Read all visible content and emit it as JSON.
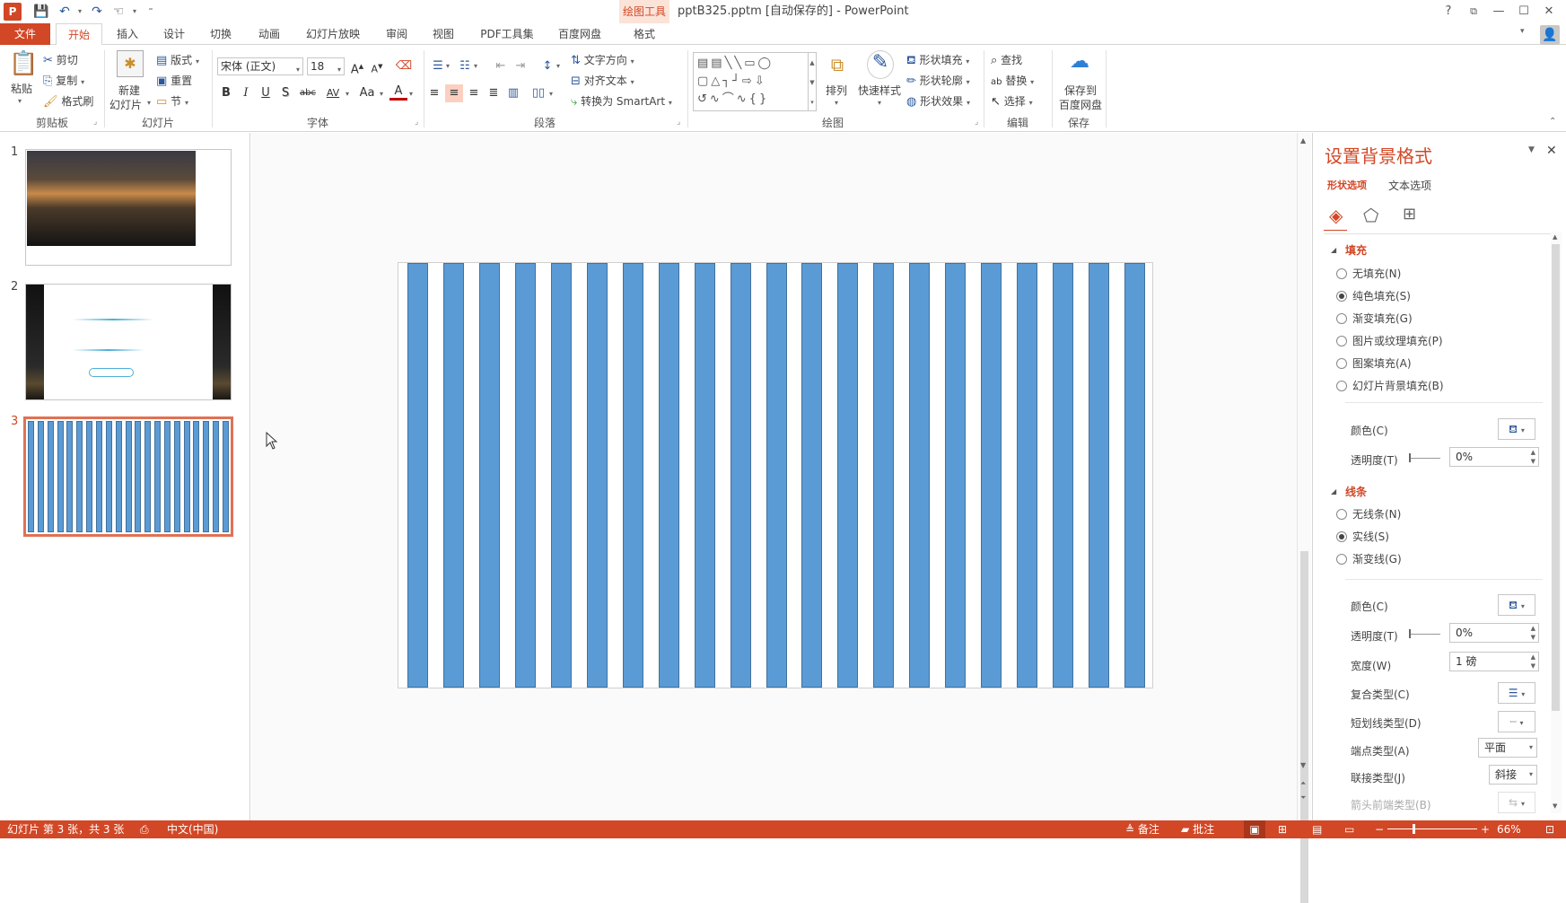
{
  "titlebar": {
    "app_icon": "P",
    "drawing_tools": "绘图工具",
    "title": "pptB325.pptm [自动保存的] - PowerPoint",
    "qat": [
      "save-icon",
      "undo-icon",
      "redo-icon",
      "touch-mode-icon",
      "customize-icon"
    ],
    "win_buttons": [
      "?",
      "restore-ribbon-icon",
      "minimize-icon",
      "maximize-icon",
      "close-icon"
    ]
  },
  "tabs": [
    "文件",
    "开始",
    "插入",
    "设计",
    "切换",
    "动画",
    "幻灯片放映",
    "审阅",
    "视图",
    "PDF工具集",
    "百度网盘",
    "格式"
  ],
  "ribbon": {
    "clipboard": {
      "paste": "粘贴",
      "cut": "剪切",
      "copy": "复制",
      "format_painter": "格式刷",
      "label": "剪贴板"
    },
    "slides": {
      "new_slide_1": "新建",
      "new_slide_2": "幻灯片",
      "layout": "版式",
      "reset": "重置",
      "section": "节",
      "label": "幻灯片"
    },
    "font": {
      "name": "宋体 (正文)",
      "size": "18",
      "bold": "B",
      "italic": "I",
      "underline": "U",
      "shadow": "S",
      "strike": "abc",
      "spacing": "AV",
      "case": "Aa",
      "color": "A",
      "label": "字体"
    },
    "paragraph": {
      "text_direction": "文字方向",
      "align_text": "对齐文本",
      "smartart": "转换为 SmartArt",
      "label": "段落"
    },
    "drawing": {
      "arrange": "排列",
      "quick_styles": "快速样式",
      "shape_fill": "形状填充",
      "shape_outline": "形状轮廓",
      "shape_effects": "形状效果",
      "label": "绘图"
    },
    "editing": {
      "find": "查找",
      "replace": "替换",
      "select": "选择",
      "label": "编辑"
    },
    "save": {
      "line1": "保存到",
      "line2": "百度网盘",
      "label": "保存"
    }
  },
  "thumbnails": [
    {
      "num": "1"
    },
    {
      "num": "2"
    },
    {
      "num": "3"
    }
  ],
  "slide": {
    "stripe_count": 21,
    "stripe_color": "#5b9bd5"
  },
  "panel": {
    "title": "设置背景格式",
    "tab_shape": "形状选项",
    "tab_text": "文本选项",
    "fill_header": "填充",
    "fill_options": [
      "无填充(N)",
      "纯色填充(S)",
      "渐变填充(G)",
      "图片或纹理填充(P)",
      "图案填充(A)",
      "幻灯片背景填充(B)"
    ],
    "fill_selected": 1,
    "fill_color_label": "颜色(C)",
    "fill_transparency_label": "透明度(T)",
    "fill_transparency": "0%",
    "line_header": "线条",
    "line_options": [
      "无线条(N)",
      "实线(S)",
      "渐变线(G)"
    ],
    "line_selected": 1,
    "line_color_label": "颜色(C)",
    "line_transparency_label": "透明度(T)",
    "line_transparency": "0%",
    "width_label": "宽度(W)",
    "width_value": "1 磅",
    "compound_label": "复合类型(C)",
    "dash_label": "短划线类型(D)",
    "cap_label": "端点类型(A)",
    "cap_value": "平面",
    "join_label": "联接类型(J)",
    "join_value": "斜接",
    "arrow_label": "箭头前端类型(B)"
  },
  "status": {
    "slide_info": "幻灯片 第 3 张，共 3 张",
    "language": "中文(中国)",
    "notes": "备注",
    "comments": "批注",
    "zoom": "66%"
  },
  "colors": {
    "accent": "#d24726",
    "stripe": "#5b9bd5"
  }
}
